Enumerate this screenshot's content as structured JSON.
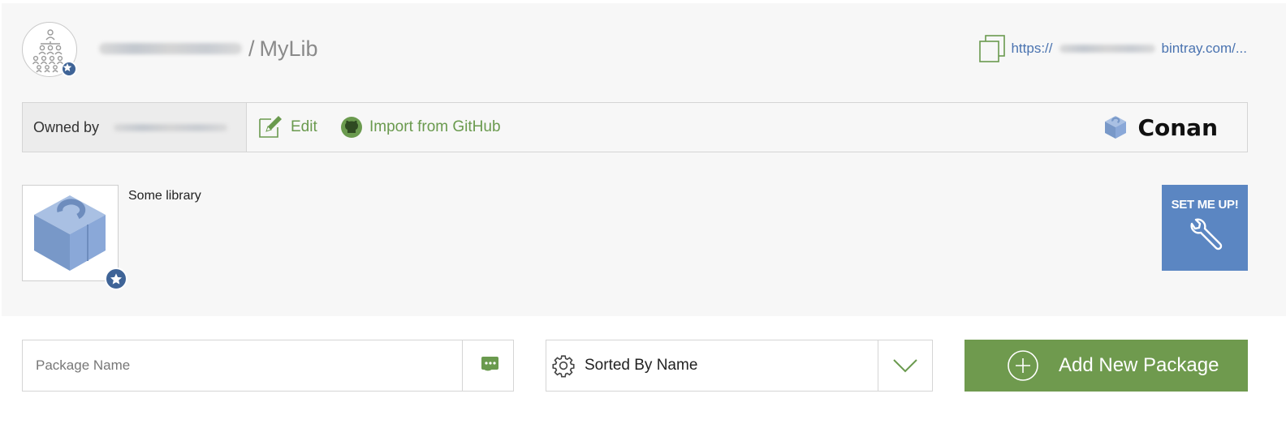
{
  "header": {
    "repo_separator": "/",
    "repo_name": "MyLib",
    "url_prefix": "https://",
    "url_suffix": "bintray.com/..."
  },
  "owner_bar": {
    "owned_by_label": "Owned by",
    "edit_label": "Edit",
    "import_label": "Import from GitHub",
    "package_type": "Conan"
  },
  "repo": {
    "description": "Some library"
  },
  "setmeup": {
    "label": "SET ME UP!"
  },
  "search": {
    "placeholder": "Package Name",
    "value": ""
  },
  "sort": {
    "selected": "Sorted By Name"
  },
  "add_package": {
    "label": "Add New Package"
  },
  "colors": {
    "accent_green": "#6f9a4e",
    "link_green": "#6a9a4e",
    "badge_blue": "#3f6497",
    "setmeup_blue": "#5b86c2",
    "link_blue": "#4a73b0"
  },
  "icons": {
    "org_avatar": "organization-icon",
    "copy": "copy-icon",
    "edit": "edit-icon",
    "github": "github-icon",
    "conan": "conan-icon",
    "wrench": "wrench-icon",
    "search": "search-chat-icon",
    "sort": "gear-icon",
    "dropdown": "chevron-down-icon",
    "add": "plus-circle-icon",
    "star": "star-icon"
  }
}
